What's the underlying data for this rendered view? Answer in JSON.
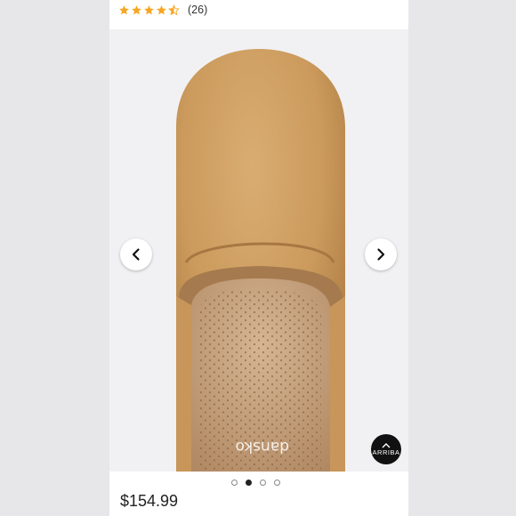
{
  "rating": {
    "stars": 4.5,
    "review_count": "(26)",
    "star_color": "#f5a623"
  },
  "gallery": {
    "brand_badge_text": "ARRIBA",
    "insole_brand": "dansko",
    "total_images": 4,
    "active_index": 1,
    "prev_icon": "chevron-left-icon",
    "next_icon": "chevron-right-icon"
  },
  "product": {
    "price": "$154.99"
  }
}
